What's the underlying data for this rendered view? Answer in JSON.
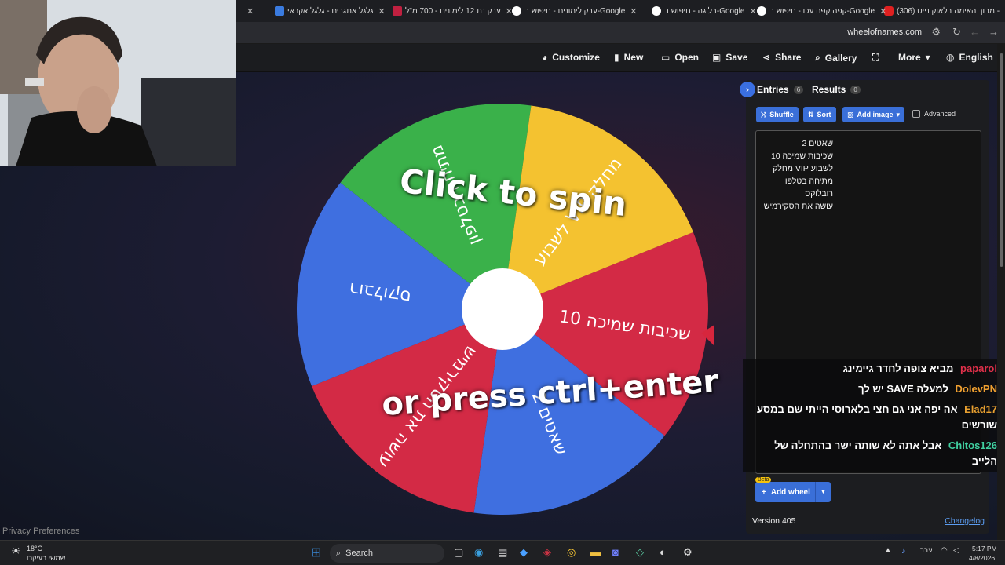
{
  "browser": {
    "tabs": [
      {
        "title": "(306) מבוך האימה בלאוק נייט -",
        "favicon_color": "#e02020"
      },
      {
        "title": "קפה קפה עכו - חיפוש ב-Google",
        "favicon_color": "#ffffff"
      },
      {
        "title": "בלוגה - חיפוש ב-Google",
        "favicon_color": "#ffffff"
      },
      {
        "title": "ערק לימונים - חיפוש ב-Google",
        "favicon_color": "#ffffff"
      },
      {
        "title": "ערק נת 12 לימונים - 700 מ\"ל",
        "favicon_color": "#c02040"
      },
      {
        "title": "גלגל אתגרים - גלגל אקראי",
        "favicon_color": "#3a7be0"
      }
    ],
    "url": "wheelofnames.com"
  },
  "toolbar": {
    "customize": "Customize",
    "new": "New",
    "open": "Open",
    "save": "Save",
    "share": "Share",
    "gallery": "Gallery",
    "more": "More",
    "language": "English"
  },
  "wheel": {
    "segments": [
      {
        "label": "שכיבות שמיכה 10",
        "color": "#d32a45"
      },
      {
        "label": "שאטים 2",
        "color": "#3f6fe0"
      },
      {
        "label": "עושה את הסקירמיש",
        "color": "#d32a45"
      },
      {
        "label": "רובלוקס",
        "color": "#3f6fe0"
      },
      {
        "label": "מתיחה בטלפון",
        "color": "#3ab14a"
      },
      {
        "label": "לשבוע VIP מחלק",
        "color": "#f4c230"
      }
    ],
    "spin_line1": "Click to spin",
    "spin_line2": "or press ctrl+enter"
  },
  "panel": {
    "entries_tab": "Entries",
    "entries_count": "6",
    "results_tab": "Results",
    "results_count": "0",
    "shuffle": "Shuffle",
    "sort": "Sort",
    "add_image": "Add image",
    "advanced": "Advanced",
    "entries": [
      "שאטים 2",
      "שכיבות שמיכה 10",
      "לשבוע VIP מחלק",
      "מתיחה בטלפון",
      "רובלוקס",
      "עושה את הסקירמיש"
    ],
    "beta": "Beta",
    "add_wheel": "Add wheel",
    "version": "Version 405",
    "changelog": "Changelog"
  },
  "chat": [
    {
      "user": "paparol",
      "user_color": "#e0304a",
      "text": "מביא צופה לחדר גיימינג"
    },
    {
      "user": "DolevPN",
      "user_color": "#f0a030",
      "text": "למעלה SAVE יש לך"
    },
    {
      "user": "Elad17",
      "user_color": "#e8a030",
      "text": "אה יפה אני גם חצי בלארוסי הייתי שם במסע שורשים"
    },
    {
      "user": "Chitos126",
      "user_color": "#40d0a0",
      "text": "אבל אתה לא שותה ישר בהתחלה של הלייב"
    }
  ],
  "privacy": "Privacy Preferences",
  "taskbar": {
    "weather_temp": "18°C",
    "weather_desc": "שמשי בעיקרו",
    "search": "Search",
    "lang": "עבר",
    "time": "5:17 PM",
    "date": "4/8/2026"
  }
}
